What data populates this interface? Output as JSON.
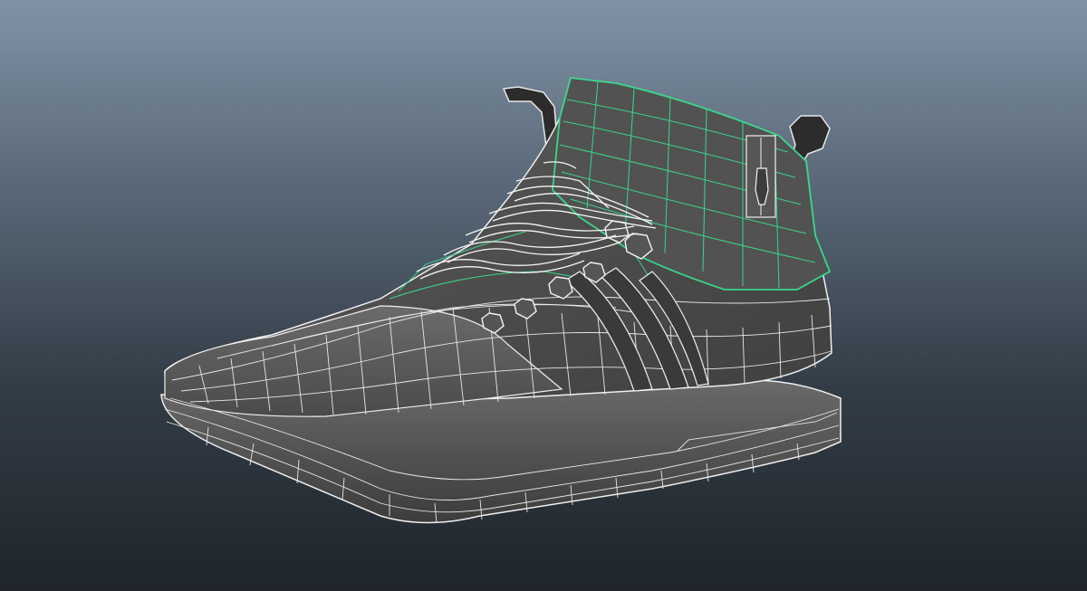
{
  "viewport": {
    "background_top": "#8093a6",
    "background_bottom": "#1f252b",
    "shading_mode": "wireframe-on-shaded"
  },
  "model": {
    "subject": "shoe",
    "surface_color": "#4b4b4b",
    "wire_color": "#e8e8e8",
    "selection_color": "#3ad68a",
    "selected_part": "upper-collar"
  }
}
